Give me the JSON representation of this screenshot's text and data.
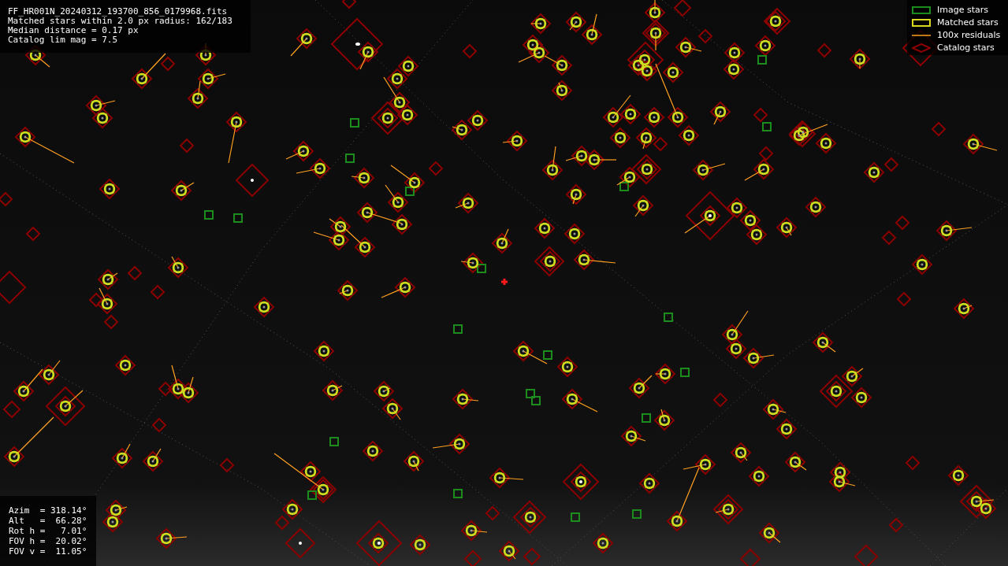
{
  "file_info": {
    "lines": [
      "FF_HR001N_20240312_193700_856_0179968.fits",
      "Matched stars within 2.0 px radius: 162/183",
      "Median distance = 0.17 px",
      "Catalog lim mag = 7.5"
    ]
  },
  "legend": [
    {
      "kind": "image",
      "label": "Image stars"
    },
    {
      "kind": "matched",
      "label": "Matched stars"
    },
    {
      "kind": "residual",
      "label": "100x residuals"
    },
    {
      "kind": "catalog",
      "label": "Catalog stars"
    }
  ],
  "pointing": {
    "lines": [
      "Azim  = 318.14°",
      "Alt   =  66.28°",
      "Rot h =   7.01°",
      "FOV h =  20.02°",
      "FOV v =  11.05°"
    ]
  }
}
